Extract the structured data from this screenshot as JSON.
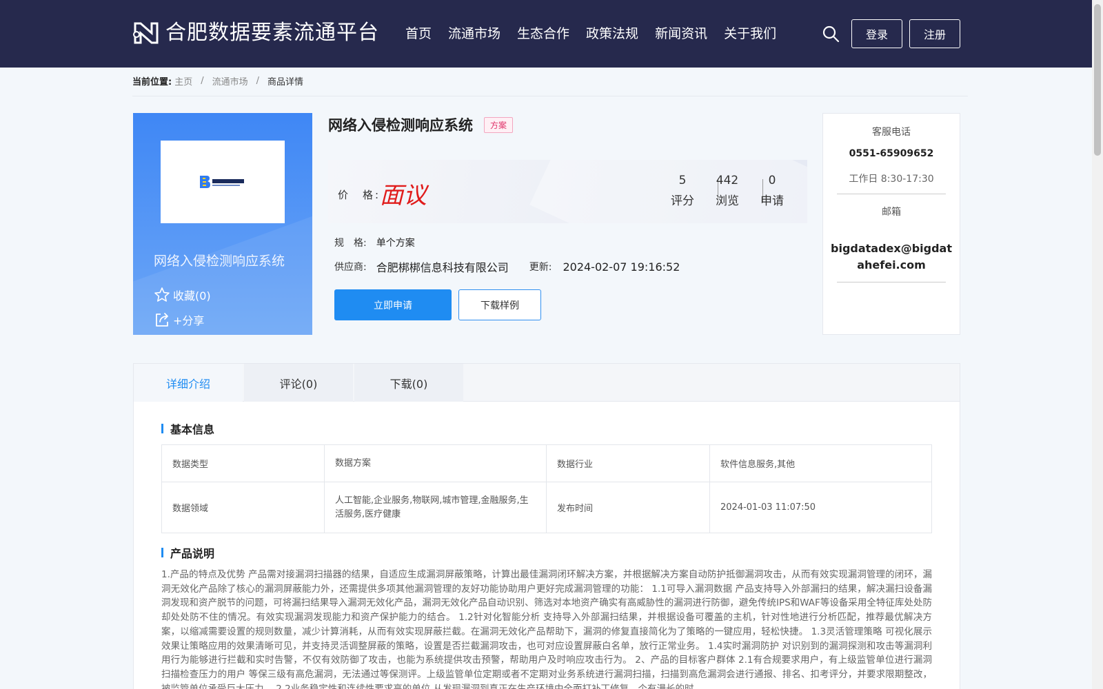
{
  "header": {
    "site_title": "合肥数据要素流通平台",
    "nav": [
      "首页",
      "流通市场",
      "生态合作",
      "政策法规",
      "新闻资讯",
      "关于我们"
    ],
    "search_icon": "search-icon",
    "login_label": "登录",
    "register_label": "注册",
    "background_color": "#26294d"
  },
  "breadcrumb": {
    "label": "当前位置:",
    "items": [
      "主页",
      "流通市场"
    ],
    "separator": "/",
    "current": "商品详情"
  },
  "product_card": {
    "title": "网络入侵检测响应系统",
    "favorite_label": "收藏(0)",
    "share_label": "+分享",
    "accent_color": "#3f87f5"
  },
  "product": {
    "name": "网络入侵检测响应系统",
    "tag": "方案",
    "price_label": "价　格:",
    "price_value": "面议",
    "stats": [
      {
        "value": "5",
        "label": "评分"
      },
      {
        "value": "442",
        "label": "浏览"
      },
      {
        "value": "0",
        "label": "申请"
      }
    ],
    "spec_label": "规　格:",
    "spec_value": "单个方案",
    "supplier_label": "供应商:",
    "supplier_value": "合肥梆梆信息科技有限公司",
    "update_label": "更新:",
    "update_value": "2024-02-07 19:16:52",
    "apply_button": "立即申请",
    "download_button": "下载样例",
    "primary_color": "#1f8cf2",
    "price_color": "#e01b1b"
  },
  "contact": {
    "phone_label": "客服电话",
    "phone": "0551-65909652",
    "hours": "工作日 8:30-17:30",
    "email_label": "邮箱",
    "email": "bigdatadex@bigdatahefei.com"
  },
  "detail": {
    "tabs": [
      "详细介绍",
      "评论(0)",
      "下载(0)"
    ],
    "active_tab": "详细介绍",
    "basic_info_title": "基本信息",
    "table": [
      [
        "数据类型",
        "数据方案",
        "数据行业",
        "软件信息服务,其他"
      ],
      [
        "数据领域",
        "人工智能,企业服务,物联网,城市管理,金融服务,生活服务,医疗健康",
        "发布时间",
        "2024-01-03 11:07:50"
      ]
    ],
    "description_title": "产品说明",
    "description": "1.产品的特点及优势 产品需对接漏洞扫描器的结果，自适应生成漏洞屏蔽策略，计算出最佳漏洞闭环解决方案，并根据解决方案自动防护抵御漏洞攻击，从而有效实现漏洞管理的闭环，漏洞无效化产品除了核心的漏洞屏蔽能力外，还需提供多项其他漏洞管理的友好功能协助用户更好完成漏洞管理的功能： 1.1可导入漏洞数据 产品支持导入外部漏扫的结果，解决漏扫设备漏洞发现和资产脱节的问题，可将漏扫结果导入漏洞无效化产品，漏洞无效化产品自动识别、筛选对本地资产确实有高威胁性的漏洞进行防御，避免传统IPS和WAF等设备采用全特征库处处防却处处防不住的情况。有效实现漏洞发现能力和资产保护能力的结合。 1.2针对化智能分析 支持导入外部漏扫结果，并根据设备可覆盖的主机，针对性地进行分析匹配，推荐最优解决方案，以缩减需要设置的规则数量，减少计算消耗，从而有效实现屏蔽拦截。在漏洞无效化产品帮助下，漏洞的修复直接简化为了策略的一键应用，轻松快捷。 1.3灵活管理策略 可视化展示效果让策略应用的效果清晰可见，并支持灵活调整屏蔽的策略，设置是否拦截漏洞攻击，也可对应设置屏蔽白名单，放行正常业务。 1.4实时漏洞防护 对识别到的漏洞探测和攻击等漏洞利用行为能够进行拦截和实时告警，不仅有效防御了攻击，也能为系统提供攻击预警，帮助用户及时响应攻击行为。 2、产品的目标客户群体 2.1有合规要求用户，有上级监管单位进行漏洞扫描检查压力的用户 等保三级有高危漏洞，无法通过等保测评。上级监管单位定期或者不定期对业务系统进行漏洞扫描，扫描到高危漏洞会进行通报、排名、扣考评分，并要求限期整改，被监管单位承受巨大压力。 2.2业务稳定性和连续性要求高的单位 从发现漏洞到真正在生产环境中全面打补丁修复，个有漫长的时"
  }
}
